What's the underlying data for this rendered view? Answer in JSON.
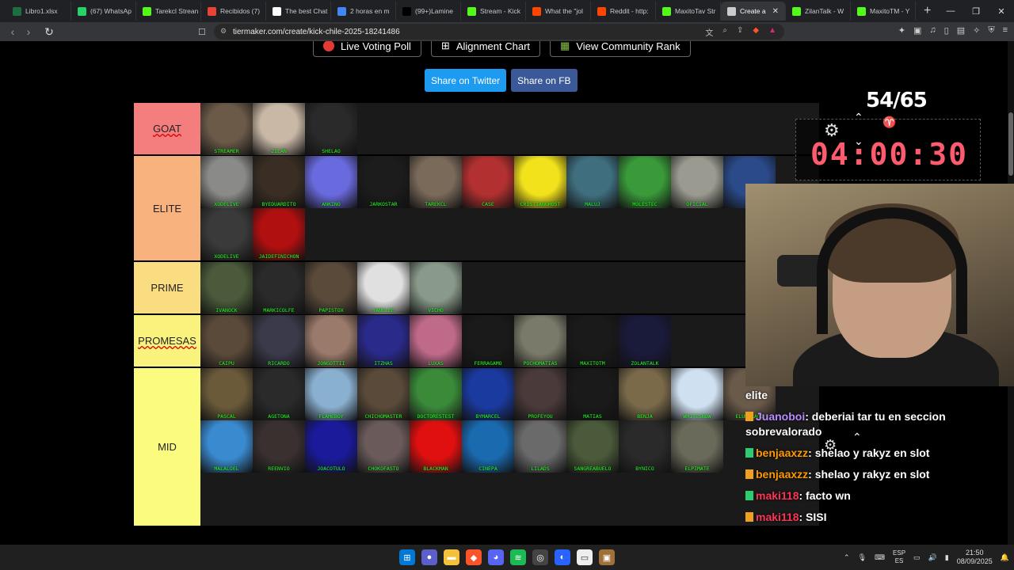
{
  "browser": {
    "tabs": [
      {
        "label": "Libro1.xlsx",
        "color": "#1d6f42"
      },
      {
        "label": "(67) WhatsAp",
        "color": "#25d366"
      },
      {
        "label": "Tarekcl Strean",
        "color": "#53fc18"
      },
      {
        "label": "Recibidos (7)",
        "color": "#ea4335"
      },
      {
        "label": "The best Chat",
        "color": "#ffffff"
      },
      {
        "label": "2 horas en m",
        "color": "#4285f4"
      },
      {
        "label": "(99+)Lamine",
        "color": "#000000"
      },
      {
        "label": "Stream - Kick",
        "color": "#53fc18"
      },
      {
        "label": "What the \"jol",
        "color": "#ff4500"
      },
      {
        "label": "Reddit - http:",
        "color": "#ff4500"
      },
      {
        "label": "MaxitoTav Str",
        "color": "#53fc18"
      },
      {
        "label": "Create a",
        "color": "#cccccc",
        "active": true
      },
      {
        "label": "ZilanTalk - W",
        "color": "#53fc18"
      },
      {
        "label": "MaxitoTM - Y",
        "color": "#53fc18"
      }
    ],
    "url": "tiermaker.com/create/kick-chile-2025-18241486"
  },
  "page": {
    "live_poll_label": "Live Voting Poll",
    "alignment_label": "Alignment Chart",
    "community_label": "View Community Rank",
    "share_twitter": "Share on Twitter",
    "share_fb": "Share on FB"
  },
  "tiers": [
    {
      "label": "GOAT",
      "color": "#f47e7e",
      "items": [
        {
          "name": "STREAMER",
          "color": "#6b5a48"
        },
        {
          "name": "ZILAN",
          "color": "#c9b8a6"
        },
        {
          "name": "SHELAO",
          "color": "#2a2a2a"
        }
      ]
    },
    {
      "label": "ELITE",
      "color": "#f7b27e",
      "items": [
        {
          "name": "XODELIVE",
          "color": "#8a8a88"
        },
        {
          "name": "BYEDUARDITO",
          "color": "#3a2e24"
        },
        {
          "name": "ANKINO",
          "color": "#6a6adf"
        },
        {
          "name": "JARKOSTAR",
          "color": "#1c1c1c"
        },
        {
          "name": "TAREKCL",
          "color": "#7a6a5a"
        },
        {
          "name": "CASE",
          "color": "#b23030"
        },
        {
          "name": "CRISTIANGHOST",
          "color": "#f2e21c"
        },
        {
          "name": "MALUJ",
          "color": "#3f6f7f"
        },
        {
          "name": "MOLESTEC",
          "color": "#3a9a3a"
        },
        {
          "name": "OFICIAL",
          "color": "#9a9a90"
        },
        {
          "name": "",
          "color": "#2a4a8a"
        },
        {
          "name": "XODELIVE",
          "color": "#3a3a3a"
        },
        {
          "name": "JAIDEFINICHON",
          "color": "#b01010"
        }
      ]
    },
    {
      "label": "PRIME",
      "color": "#f9dd80",
      "items": [
        {
          "name": "IVANOCK",
          "color": "#4a5a3a"
        },
        {
          "name": "MARKICOLFE",
          "color": "#2a2a2a"
        },
        {
          "name": "PAPISTOX",
          "color": "#5a4a3a"
        },
        {
          "name": "YANGLEE",
          "color": "#e0e0e0"
        },
        {
          "name": "VICHO",
          "color": "#8a9a8a"
        }
      ]
    },
    {
      "label": "PROMESAS",
      "color": "#f9f37e",
      "items": [
        {
          "name": "CAIPU",
          "color": "#5a4a3a"
        },
        {
          "name": "RICARDO",
          "color": "#3a3a4a"
        },
        {
          "name": "JONGOTTII",
          "color": "#9a7a6a"
        },
        {
          "name": "ITZHAS",
          "color": "#2a2a8a"
        },
        {
          "name": "LUXAS",
          "color": "#c06a8a"
        },
        {
          "name": "FERRAGAMO",
          "color": "#1a1a1a"
        },
        {
          "name": "POCHOMATIAS",
          "color": "#7a7a6a"
        },
        {
          "name": "MAXITOTM",
          "color": "#1a1a1a"
        },
        {
          "name": "ZOLANTALK",
          "color": "#1a1a3a"
        }
      ]
    },
    {
      "label": "MID",
      "color": "#fbfb7f",
      "items": [
        {
          "name": "PASCAL",
          "color": "#6a5a3a"
        },
        {
          "name": "AGETONA",
          "color": "#2a2a2a"
        },
        {
          "name": "FLAMEBOY",
          "color": "#8ab0d0"
        },
        {
          "name": "CHICHOMASTER",
          "color": "#5a4a3a"
        },
        {
          "name": "DOCTORESTEST",
          "color": "#3a8a3a"
        },
        {
          "name": "BYMARCEL",
          "color": "#1a3aa0"
        },
        {
          "name": "PROFEYOU",
          "color": "#4a3a3a"
        },
        {
          "name": "MATIAS",
          "color": "#1a1a1a"
        },
        {
          "name": "BENJA",
          "color": "#7a6a4a"
        },
        {
          "name": "WHITESNOW",
          "color": "#cfe0f0"
        },
        {
          "name": "ELUKDRAGO",
          "color": "#6a5a4a"
        },
        {
          "name": "MALALOEL",
          "color": "#3a8ad0"
        },
        {
          "name": "REENVIO",
          "color": "#3a3030"
        },
        {
          "name": "JOACOTULO",
          "color": "#1a1a9a"
        },
        {
          "name": "CHOKOFASTO",
          "color": "#6a5a5a"
        },
        {
          "name": "BLACKMAN",
          "color": "#e01010"
        },
        {
          "name": "CINEPA",
          "color": "#1a6ab0"
        },
        {
          "name": "LILADS",
          "color": "#6a6a6a"
        },
        {
          "name": "SANGREABUELO",
          "color": "#4a5a3a"
        },
        {
          "name": "BYNICO",
          "color": "#2a2a2a"
        },
        {
          "name": "ELPIMATE",
          "color": "#6a6a5a"
        }
      ]
    }
  ],
  "overlay": {
    "counter": "54/65",
    "timer": "04:00:30"
  },
  "chat": [
    {
      "user": "",
      "text": "elite",
      "user_color": "#ffffff"
    },
    {
      "user": "Juanoboi",
      "text": ": deberiai tar tu en seccion sobrevalorado",
      "user_color": "#b98cff"
    },
    {
      "user": "benjaaxzz",
      "text": ": shelao y rakyz en slot",
      "user_color": "#ff9900"
    },
    {
      "user": "benjaaxzz",
      "text": ": shelao y rakyz en slot",
      "user_color": "#ff9900"
    },
    {
      "user": "maki118",
      "text": ": facto wn",
      "user_color": "#ff3355"
    },
    {
      "user": "maki118",
      "text": ": SISI",
      "user_color": "#ff3355"
    }
  ],
  "taskbar": {
    "lang_top": "ESP",
    "lang_bottom": "ES",
    "time": "21:50",
    "date": "08/09/2025"
  }
}
